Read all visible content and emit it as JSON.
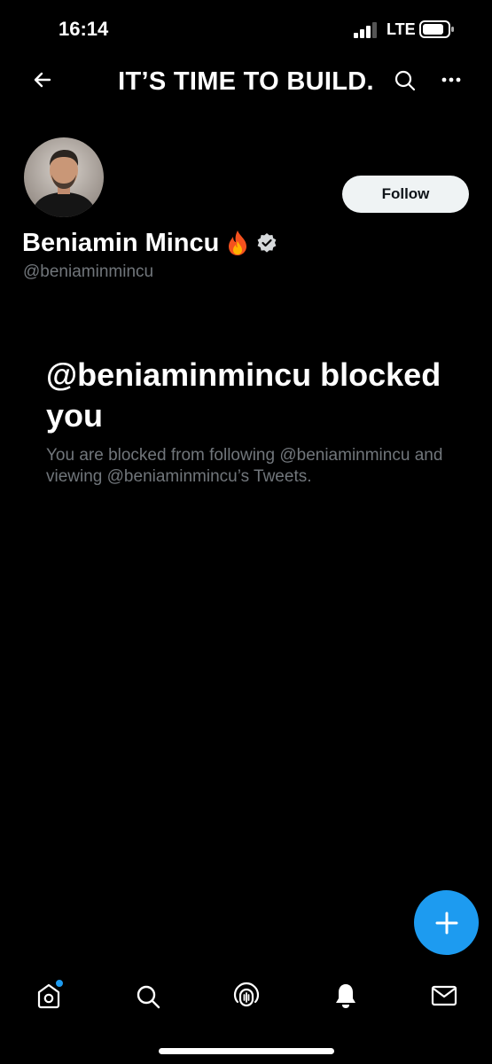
{
  "status_bar": {
    "time": "16:14",
    "network": "LTE"
  },
  "header": {
    "banner_title": "IT’S TIME TO BUILD."
  },
  "profile": {
    "name": "Beniamin Mincu",
    "handle": "@beniaminmincu",
    "follow_label": "Follow",
    "verified": true
  },
  "blocked": {
    "title": "@beniaminmincu blocked you",
    "description": "You are blocked from following @beniaminmincu and viewing @beniaminmincu’s Tweets."
  },
  "bottom_nav": {
    "items": [
      "home-icon",
      "search-icon",
      "spaces-icon",
      "notifications-icon",
      "messages-icon"
    ],
    "home_has_new": true
  },
  "colors": {
    "accent": "#1d9bf0",
    "background": "#000000",
    "secondary_text": "#71767b"
  }
}
